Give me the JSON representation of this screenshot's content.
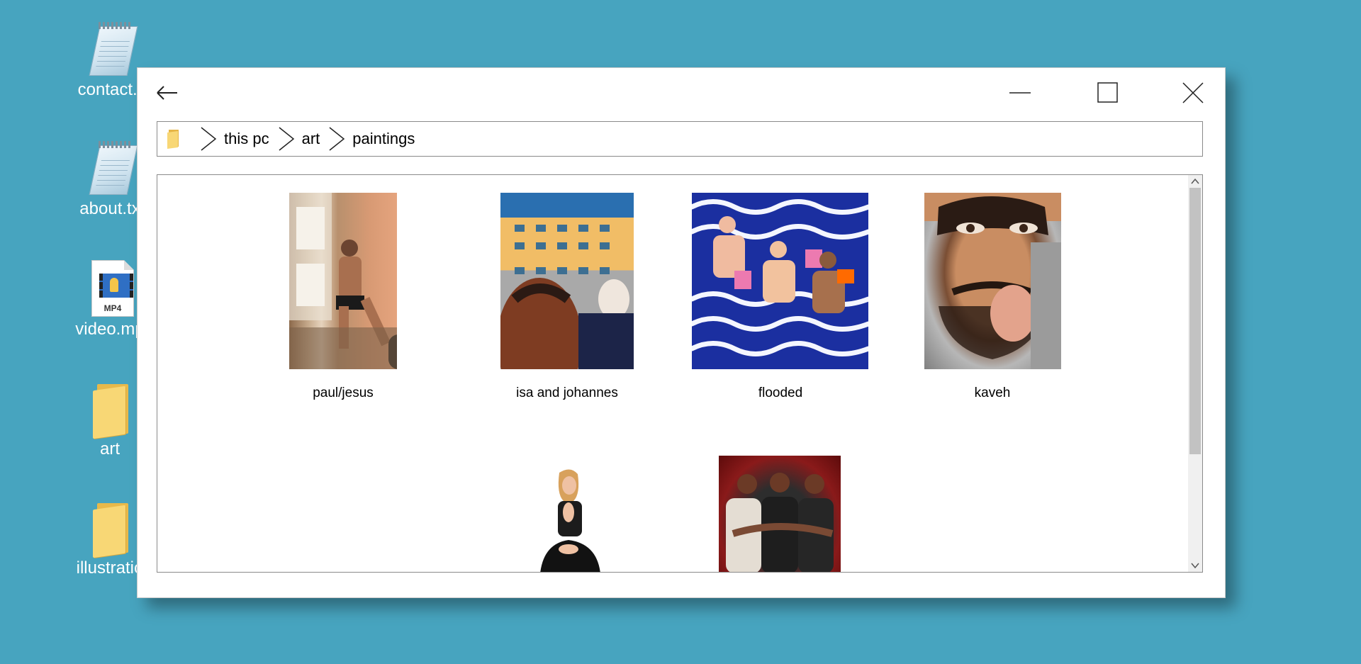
{
  "desktop": {
    "icons": [
      {
        "label": "contact.t",
        "icon": "text-file-icon"
      },
      {
        "label": "about.tx",
        "icon": "text-file-icon"
      },
      {
        "label": "video.mp",
        "icon": "video-file-icon",
        "badge": "MP4"
      },
      {
        "label": "art",
        "icon": "folder-icon"
      },
      {
        "label": "illustratio",
        "icon": "folder-icon"
      }
    ],
    "background_color": "#47a4bf"
  },
  "window": {
    "buttons": {
      "back": "back-arrow-icon",
      "minimize": "minimize-icon",
      "maximize": "maximize-icon",
      "close": "close-icon"
    },
    "breadcrumb": [
      "this pc",
      "art",
      "paintings"
    ],
    "items": [
      {
        "caption": "paul/jesus"
      },
      {
        "caption": "isa and johannes"
      },
      {
        "caption": "flooded"
      },
      {
        "caption": "kaveh"
      },
      {
        "caption": ""
      },
      {
        "caption": ""
      }
    ]
  }
}
